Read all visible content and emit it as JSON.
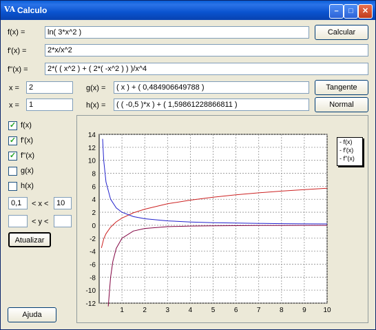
{
  "window": {
    "title": "Calculo",
    "icon_text": "VA"
  },
  "fields": {
    "f_label": "f(x) =",
    "f_value": "ln( 3*x^2 )",
    "fp_label": "f'(x) =",
    "fp_value": "2*x/x^2",
    "fpp_label": "f''(x) =",
    "fpp_value": "2*( ( x^2 ) + ( 2*( -x^2 ) ) )/x^4",
    "x1_label": "x =",
    "x1_value": "2",
    "x2_label": "x =",
    "x2_value": "1",
    "g_label": "g(x) =",
    "g_value": "( x ) + ( 0,484906649788 )",
    "h_label": "h(x) =",
    "h_value": "( ( -0,5 )*x ) + ( 1,59861228866811 )"
  },
  "buttons": {
    "calcular": "Calcular",
    "tangente": "Tangente",
    "normal": "Normal",
    "atualizar": "Atualizar",
    "ajuda": "Ajuda"
  },
  "checks": [
    {
      "label": "f(x)",
      "checked": true
    },
    {
      "label": "f'(x)",
      "checked": true
    },
    {
      "label": "f''(x)",
      "checked": true
    },
    {
      "label": "g(x)",
      "checked": false
    },
    {
      "label": "h(x)",
      "checked": false
    }
  ],
  "range": {
    "x_min": "0,1",
    "x_max": "10",
    "x_label": "< x <",
    "y_min": "",
    "y_max": "",
    "y_label": "< y <"
  },
  "legend": [
    "f(x)",
    "f'(x)",
    "f''(x)"
  ],
  "colors": {
    "f": "#cc2020",
    "fp": "#2020cc",
    "fpp": "#800040"
  },
  "chart_data": {
    "type": "line",
    "xlim": [
      0,
      10
    ],
    "ylim": [
      -12,
      14
    ],
    "x_ticks": [
      1,
      2,
      3,
      4,
      5,
      6,
      7,
      8,
      9,
      10
    ],
    "y_ticks": [
      -12,
      -10,
      -8,
      -6,
      -4,
      -2,
      0,
      2,
      4,
      6,
      8,
      10,
      12,
      14
    ],
    "grid": true,
    "legend_position": "top-right",
    "series": [
      {
        "name": "f(x)",
        "x": [
          0.1,
          0.2,
          0.3,
          0.5,
          0.75,
          1,
          1.5,
          2,
          3,
          4,
          5,
          6,
          7,
          8,
          9,
          10
        ],
        "y": [
          -3.5,
          -2.1,
          -1.31,
          -0.29,
          0.52,
          1.1,
          1.91,
          2.48,
          3.3,
          3.87,
          4.32,
          4.68,
          4.99,
          5.26,
          5.49,
          5.7
        ]
      },
      {
        "name": "f'(x)",
        "x": [
          0.15,
          0.2,
          0.3,
          0.5,
          0.75,
          1,
          1.5,
          2,
          3,
          4,
          5,
          6,
          7,
          8,
          9,
          10
        ],
        "y": [
          13.3,
          10,
          6.67,
          4,
          2.67,
          2,
          1.33,
          1,
          0.67,
          0.5,
          0.4,
          0.33,
          0.29,
          0.25,
          0.22,
          0.2
        ]
      },
      {
        "name": "f''(x)",
        "x": [
          0.4,
          0.5,
          0.6,
          0.75,
          1,
          1.5,
          2,
          3,
          4,
          5,
          6,
          7,
          8,
          9,
          10
        ],
        "y": [
          -12.5,
          -8,
          -5.56,
          -3.56,
          -2,
          -0.89,
          -0.5,
          -0.22,
          -0.13,
          -0.08,
          -0.06,
          -0.04,
          -0.03,
          -0.02,
          -0.02
        ]
      }
    ]
  }
}
